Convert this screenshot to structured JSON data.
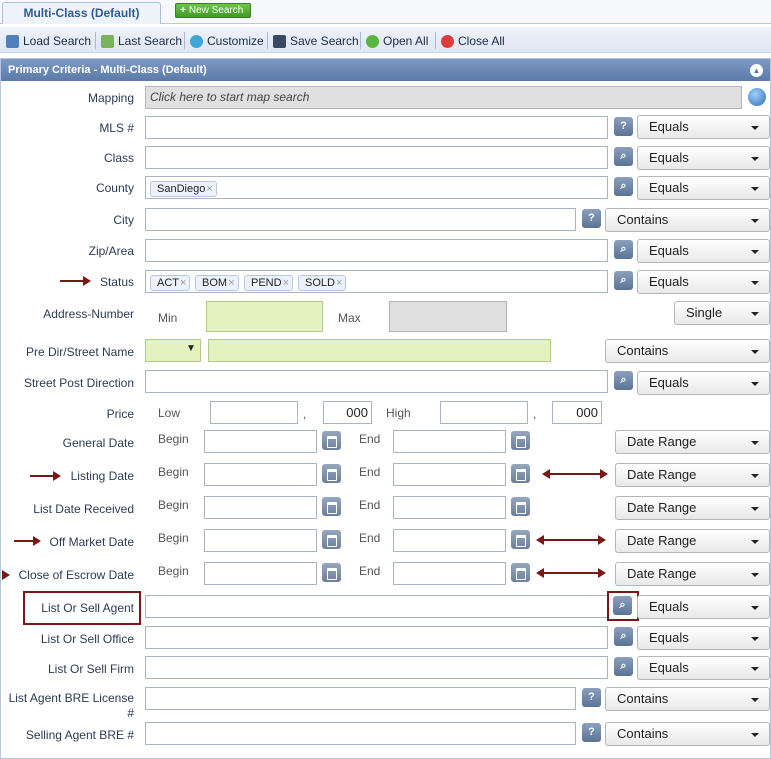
{
  "tabs": {
    "active": "Multi-Class (Default)",
    "new_search": "New Search"
  },
  "toolbar": {
    "load_search": "Load Search",
    "last_search": "Last Search",
    "customize": "Customize",
    "save_search": "Save Search",
    "open_all": "Open All",
    "close_all": "Close All"
  },
  "panel": {
    "title": "Primary Criteria - Multi-Class (Default)"
  },
  "fields": {
    "mapping": {
      "label": "Mapping",
      "placeholder": "Click here to start map search"
    },
    "mls": {
      "label": "MLS #",
      "operator": "Equals"
    },
    "class": {
      "label": "Class",
      "operator": "Equals"
    },
    "county": {
      "label": "County",
      "operator": "Equals",
      "chips": [
        "SanDiego"
      ]
    },
    "city": {
      "label": "City",
      "operator": "Contains"
    },
    "zip": {
      "label": "Zip/Area",
      "operator": "Equals"
    },
    "status": {
      "label": "Status",
      "operator": "Equals",
      "chips": [
        "ACT",
        "BOM",
        "PEND",
        "SOLD"
      ]
    },
    "address_number": {
      "label": "Address-Number",
      "min": "Min",
      "max": "Max",
      "operator": "Single"
    },
    "street_name": {
      "label": "Pre Dir/Street Name",
      "operator": "Contains"
    },
    "street_post": {
      "label": "Street Post Direction",
      "operator": "Equals"
    },
    "price": {
      "label": "Price",
      "low": "Low",
      "high": "High",
      "comma": ",",
      "low_suffix": "000",
      "high_suffix": "000"
    },
    "general_date": {
      "label": "General Date",
      "operator": "Date Range"
    },
    "listing_date": {
      "label": "Listing Date",
      "operator": "Date Range"
    },
    "list_date_received": {
      "label": "List Date Received",
      "operator": "Date Range"
    },
    "off_market_date": {
      "label": "Off Market Date",
      "operator": "Date Range"
    },
    "close_escrow_date": {
      "label": "Close of Escrow Date",
      "operator": "Date Range"
    },
    "date_begin": "Begin",
    "date_end": "End",
    "list_sell_agent": {
      "label": "List Or Sell Agent",
      "operator": "Equals"
    },
    "list_sell_office": {
      "label": "List Or Sell Office",
      "operator": "Equals"
    },
    "list_sell_firm": {
      "label": "List Or Sell Firm",
      "operator": "Equals"
    },
    "list_agent_bre": {
      "label": "List Agent BRE License #",
      "operator": "Contains"
    },
    "selling_agent_bre": {
      "label": "Selling Agent BRE #",
      "operator": "Contains"
    }
  },
  "icons": {
    "help": "?",
    "lookup": "search-icon",
    "calendar": "calendar-icon"
  },
  "colors": {
    "header": "#5a7aa8",
    "annotation": "#7a1717",
    "green_field": "#e2f3bf"
  }
}
